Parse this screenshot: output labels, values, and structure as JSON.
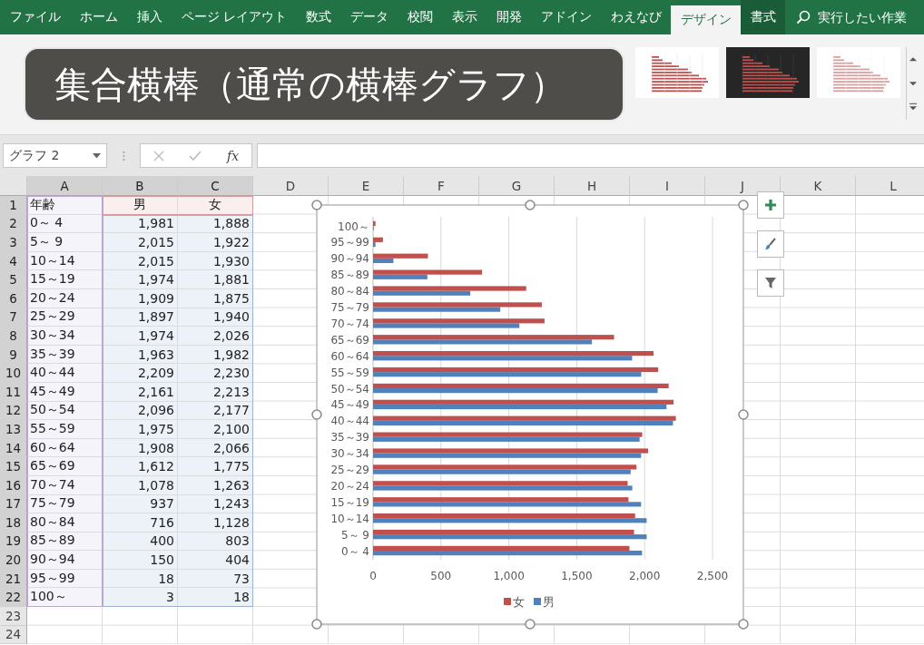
{
  "ribbon_tabs": [
    {
      "label": "ファイル",
      "selected": false
    },
    {
      "label": "ホーム",
      "selected": false
    },
    {
      "label": "挿入",
      "selected": false
    },
    {
      "label": "ページ レイアウト",
      "selected": false
    },
    {
      "label": "数式",
      "selected": false
    },
    {
      "label": "データ",
      "selected": false
    },
    {
      "label": "校閲",
      "selected": false
    },
    {
      "label": "表示",
      "selected": false
    },
    {
      "label": "開発",
      "selected": false
    },
    {
      "label": "アドイン",
      "selected": false
    },
    {
      "label": "わえなび",
      "selected": false
    },
    {
      "label": "デザイン",
      "selected": true
    },
    {
      "label": "書式",
      "selected": false
    }
  ],
  "tell_me": {
    "placeholder": "実行したい作業"
  },
  "caption": "集合横棒（通常の横棒グラフ）",
  "name_box": {
    "value": "グラフ 2"
  },
  "formula_bar": {
    "function_button": "fx"
  },
  "sheet": {
    "columns": [
      {
        "label": "A",
        "selected": true
      },
      {
        "label": "B",
        "selected": true
      },
      {
        "label": "C",
        "selected": true
      },
      {
        "label": "D",
        "selected": false
      },
      {
        "label": "E",
        "selected": false
      },
      {
        "label": "F",
        "selected": false
      },
      {
        "label": "G",
        "selected": false
      },
      {
        "label": "H",
        "selected": false
      },
      {
        "label": "I",
        "selected": false
      },
      {
        "label": "J",
        "selected": false
      },
      {
        "label": "K",
        "selected": false
      },
      {
        "label": "L",
        "selected": false
      }
    ],
    "rows": [
      {
        "number": "1",
        "selected": true,
        "cells": [
          "年齢",
          "男",
          "女"
        ]
      },
      {
        "number": "2",
        "selected": true,
        "cells": [
          "0～ 4",
          "1,981",
          "1,888"
        ]
      },
      {
        "number": "3",
        "selected": true,
        "cells": [
          "5～ 9",
          "2,015",
          "1,922"
        ]
      },
      {
        "number": "4",
        "selected": true,
        "cells": [
          "10～14",
          "2,015",
          "1,930"
        ]
      },
      {
        "number": "5",
        "selected": true,
        "cells": [
          "15～19",
          "1,974",
          "1,881"
        ]
      },
      {
        "number": "6",
        "selected": true,
        "cells": [
          "20～24",
          "1,909",
          "1,875"
        ]
      },
      {
        "number": "7",
        "selected": true,
        "cells": [
          "25～29",
          "1,897",
          "1,940"
        ]
      },
      {
        "number": "8",
        "selected": true,
        "cells": [
          "30～34",
          "1,974",
          "2,026"
        ]
      },
      {
        "number": "9",
        "selected": true,
        "cells": [
          "35～39",
          "1,963",
          "1,982"
        ]
      },
      {
        "number": "10",
        "selected": true,
        "cells": [
          "40～44",
          "2,209",
          "2,230"
        ]
      },
      {
        "number": "11",
        "selected": true,
        "cells": [
          "45～49",
          "2,161",
          "2,213"
        ]
      },
      {
        "number": "12",
        "selected": true,
        "cells": [
          "50～54",
          "2,096",
          "2,177"
        ]
      },
      {
        "number": "13",
        "selected": true,
        "cells": [
          "55～59",
          "1,975",
          "2,100"
        ]
      },
      {
        "number": "14",
        "selected": true,
        "cells": [
          "60～64",
          "1,908",
          "2,066"
        ]
      },
      {
        "number": "15",
        "selected": true,
        "cells": [
          "65～69",
          "1,612",
          "1,775"
        ]
      },
      {
        "number": "16",
        "selected": true,
        "cells": [
          "70～74",
          "1,078",
          "1,263"
        ]
      },
      {
        "number": "17",
        "selected": true,
        "cells": [
          "75～79",
          "937",
          "1,243"
        ]
      },
      {
        "number": "18",
        "selected": true,
        "cells": [
          "80～84",
          "716",
          "1,128"
        ]
      },
      {
        "number": "19",
        "selected": true,
        "cells": [
          "85～89",
          "400",
          "803"
        ]
      },
      {
        "number": "20",
        "selected": true,
        "cells": [
          "90～94",
          "150",
          "404"
        ]
      },
      {
        "number": "21",
        "selected": true,
        "cells": [
          "95～99",
          "18",
          "73"
        ]
      },
      {
        "number": "22",
        "selected": true,
        "cells": [
          "100～",
          "3",
          "18"
        ]
      },
      {
        "number": "23",
        "selected": false
      },
      {
        "number": "24",
        "selected": false
      }
    ]
  },
  "chart": {
    "chart_data": {
      "type": "bar",
      "orientation": "horizontal",
      "categories": [
        "100～",
        "95～99",
        "90～94",
        "85～89",
        "80～84",
        "75～79",
        "70～74",
        "65～69",
        "60～64",
        "55～59",
        "50～54",
        "45～49",
        "40～44",
        "35～39",
        "30～34",
        "25～29",
        "20～24",
        "15～19",
        "10～14",
        "5～ 9",
        "0～ 4"
      ],
      "series": [
        {
          "name": "男",
          "color": "#4f81bd",
          "values": [
            3,
            18,
            150,
            400,
            716,
            937,
            1078,
            1612,
            1908,
            1975,
            2096,
            2161,
            2209,
            1963,
            1974,
            1897,
            1909,
            1974,
            2015,
            2015,
            1981
          ]
        },
        {
          "name": "女",
          "color": "#c0504d",
          "values": [
            18,
            73,
            404,
            803,
            1128,
            1243,
            1263,
            1775,
            2066,
            2100,
            2177,
            2213,
            2230,
            1982,
            2026,
            1940,
            1875,
            1881,
            1930,
            1922,
            1888
          ]
        }
      ],
      "grid": true,
      "legend": true,
      "xlim": [
        0,
        2500
      ],
      "xticks": [
        0,
        500,
        {
          "value": 1000,
          "label": "1,000"
        },
        {
          "value": 1500,
          "label": "1,500"
        },
        {
          "value": 2000,
          "label": "2,000"
        },
        {
          "value": 2500,
          "label": "2,500"
        }
      ]
    }
  }
}
